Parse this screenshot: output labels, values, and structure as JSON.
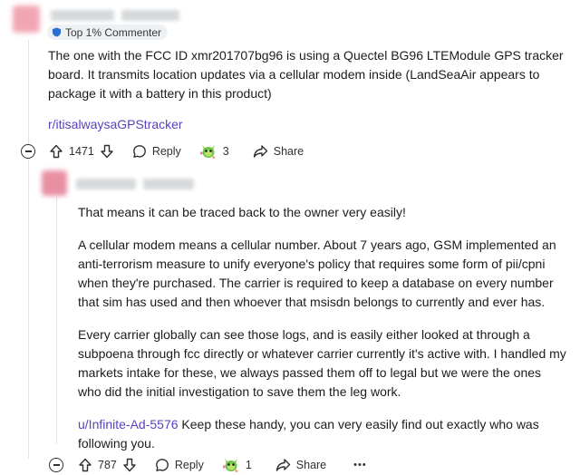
{
  "comment1": {
    "flair_text": "Top 1% Commenter",
    "body_text": "The one with the FCC ID xmr201707bg96 is using a Quectel BG96 LTEModule GPS tracker board. It transmits location updates via a cellular modem inside (LandSeaAir appears to package it with a battery in this product)",
    "subreddit_link": "r/itisalwaysaGPStracker",
    "vote_count": "1471",
    "reply_label": "Reply",
    "award_count": "3",
    "share_label": "Share"
  },
  "comment2": {
    "paragraphs": [
      "That means it can be traced back to the owner very easily!",
      "A cellular modem means a cellular number. About 7 years ago, GSM implemented an anti-terrorism measure to unify everyone's policy that requires some form of pii/cpni when they're purchased. The carrier is required to keep a database on every number that sim has used and then whoever that msisdn belongs to currently and ever has.",
      "Every carrier globally can see those logs, and is easily either looked at through a subpoena through fcc directly or whatever carrier currently it's active with. I handled my markets intake for these, we always passed them off to legal but we were the ones who did the initial investigation to save them the leg work."
    ],
    "mention_link": "u/Infinite-Ad-5576",
    "mention_text": " Keep these handy, you can very easily find out exactly who was following you.",
    "vote_count": "787",
    "reply_label": "Reply",
    "award_count": "1",
    "share_label": "Share",
    "more_label": "•••"
  },
  "colors": {
    "link": "#5a3fc0",
    "text": "#1c1c1c",
    "thread_line": "#e0e3e6"
  }
}
